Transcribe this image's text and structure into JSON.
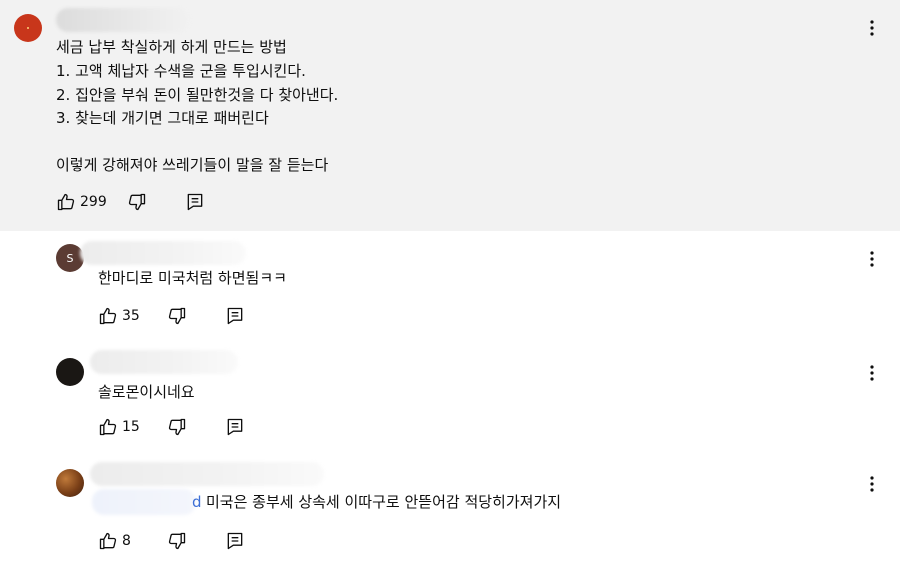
{
  "main_comment": {
    "lines": [
      "세금 납부 착실하게 하게 만드는 방법",
      "1. 고액 체납자 수색을 군을 투입시킨다.",
      "2. 집안을 부숴 돈이 될만한것을 다 찾아낸다.",
      "3. 찾는데 개기면 그대로 패버린다",
      "이렇게 강해져야 쓰레기들이 말을 잘 듣는다"
    ],
    "likes": "299"
  },
  "replies": [
    {
      "avatar_letter": "S",
      "text": "한마디로 미국처럼 하면됨ㅋㅋ",
      "likes": "35"
    },
    {
      "avatar_letter": "",
      "text": "솔로몬이시네요",
      "likes": "15"
    },
    {
      "avatar_letter": "",
      "mention_tail": "d",
      "text": "미국은 종부세 상속세 이따구로 안뜯어감 적당히가져가지",
      "likes": "8"
    }
  ],
  "icons": {
    "like": "thumbs-up-icon",
    "dislike": "thumbs-down-icon",
    "reply": "reply-comment-icon",
    "more": "more-vertical-icon"
  },
  "colors": {
    "highlight_bg": "#f2f2f2",
    "mention": "#3d6fd6",
    "avatar_main": "#c8361b"
  }
}
